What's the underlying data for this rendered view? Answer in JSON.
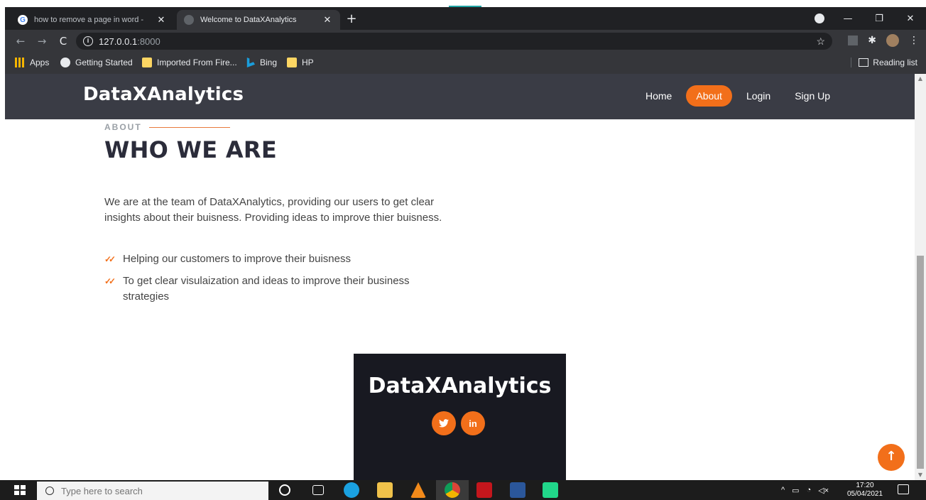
{
  "browser": {
    "tabs": [
      {
        "title": "how to remove a page in word -",
        "active": false
      },
      {
        "title": "Welcome to DataXAnalytics",
        "active": true
      }
    ],
    "new_tab_label": "+",
    "address": {
      "host": "127.0.0.1",
      "port": ":8000"
    },
    "bookmarks": [
      "Apps",
      "Getting Started",
      "Imported From Fire...",
      "Bing",
      "HP"
    ],
    "reading_list": "Reading list"
  },
  "site": {
    "logo": "DataXAnalytics",
    "nav": [
      {
        "label": "Home",
        "active": false
      },
      {
        "label": "About",
        "active": true
      },
      {
        "label": "Login",
        "active": false
      },
      {
        "label": "Sign Up",
        "active": false
      }
    ],
    "section_label": "ABOUT",
    "heading": "WHO WE ARE",
    "paragraph": "We are at the team of DataXAnalytics, providing our users to get clear insights about their buisness. Providing ideas to improve thier buisness.",
    "features": [
      "Helping our customers to improve their buisness",
      "To get clear visulaization and ideas to improve their business strategies"
    ],
    "footer_logo": "DataXAnalytics",
    "socials": [
      "twitter-icon",
      "linkedin-icon"
    ],
    "social_labels": {
      "linkedin": "in"
    },
    "accent_color": "#f26f1a",
    "header_color": "#3a3c45"
  },
  "taskbar": {
    "search_placeholder": "Type here to search",
    "time": "17:20",
    "date": "05/04/2021"
  }
}
